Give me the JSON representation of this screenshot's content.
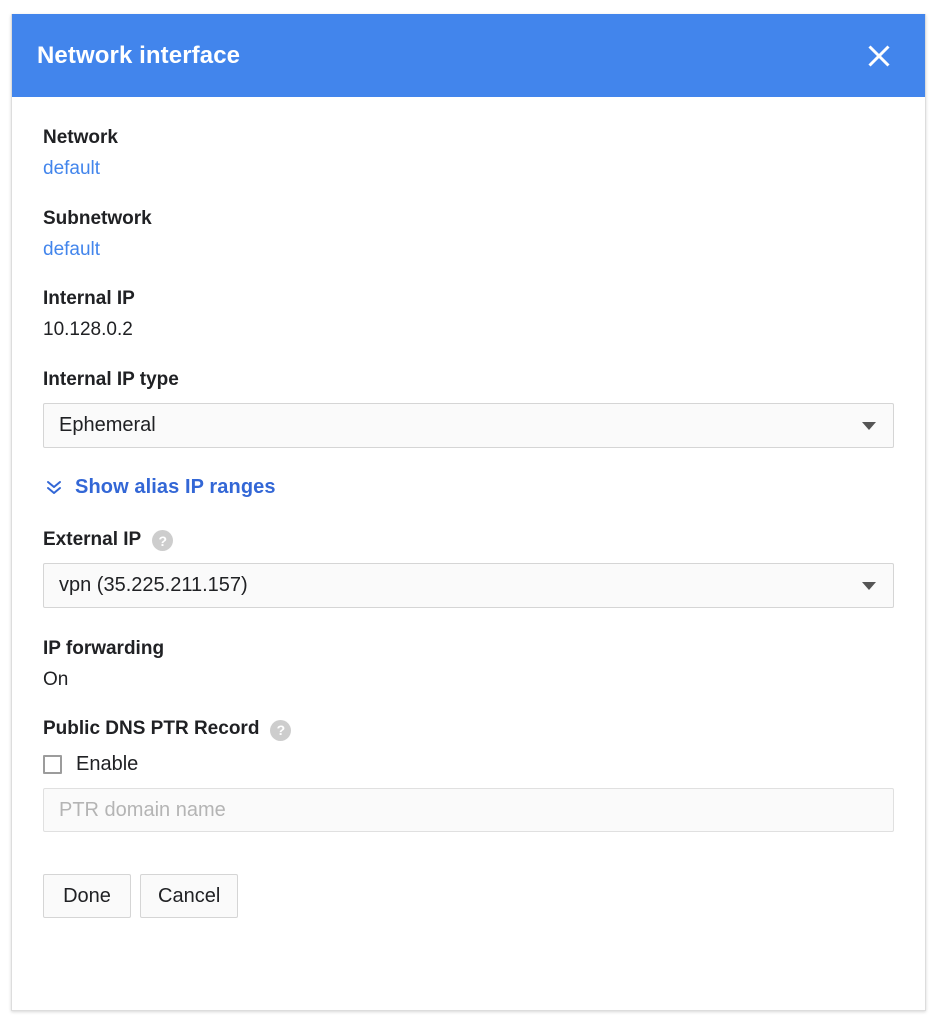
{
  "dialog": {
    "title": "Network interface",
    "close_icon": "close-icon",
    "header_color": "#4285ec"
  },
  "fields": {
    "network": {
      "label": "Network",
      "value": "default"
    },
    "subnetwork": {
      "label": "Subnetwork",
      "value": "default"
    },
    "internal_ip": {
      "label": "Internal IP",
      "value": "10.128.0.2"
    },
    "internal_ip_type": {
      "label": "Internal IP type",
      "value": "Ephemeral",
      "caret_icon": "chevron-down-icon"
    },
    "alias_ip": {
      "label": "Show alias IP ranges",
      "icon": "double-chevron-down-icon"
    },
    "external_ip": {
      "label": "External IP",
      "help_icon": "help-icon",
      "help_glyph": "?",
      "value": "vpn (35.225.211.157)",
      "caret_icon": "chevron-down-icon"
    },
    "ip_forwarding": {
      "label": "IP forwarding",
      "value": "On"
    },
    "public_dns_ptr": {
      "label": "Public DNS PTR Record",
      "help_icon": "help-icon",
      "help_glyph": "?",
      "checkbox_label": "Enable",
      "checked": false,
      "ptr_placeholder": "PTR domain name"
    }
  },
  "actions": {
    "done_label": "Done",
    "cancel_label": "Cancel"
  },
  "colors": {
    "accent_blue": "#4285ec",
    "link_blue": "#3367d6",
    "text": "#202124",
    "placeholder": "#b4b4b4"
  }
}
